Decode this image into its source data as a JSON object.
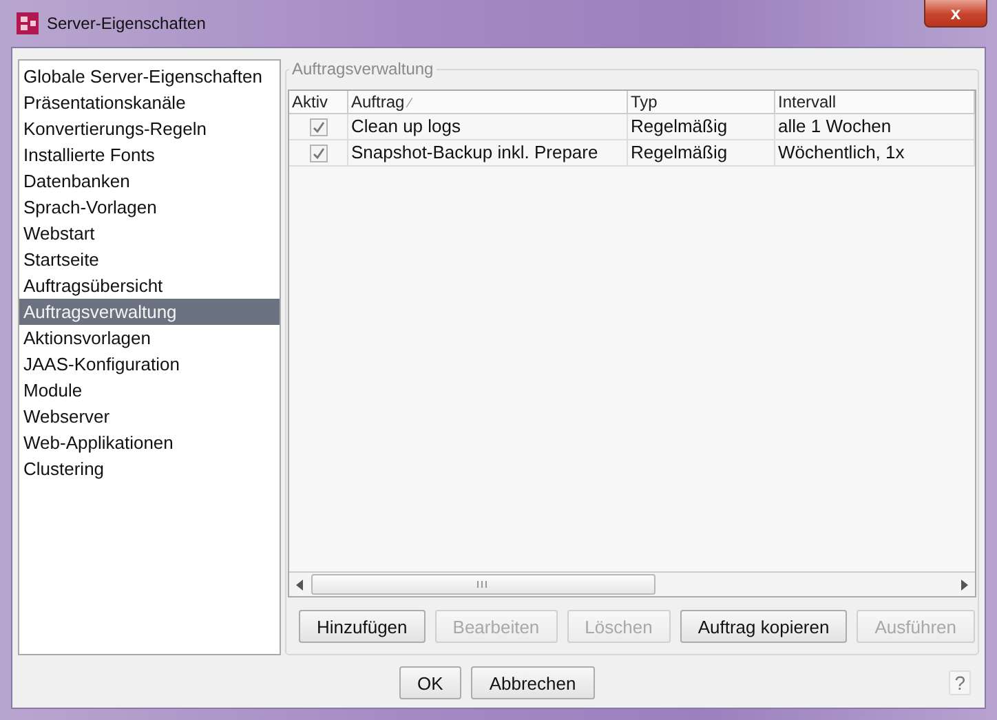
{
  "window": {
    "title": "Server-Eigenschaften",
    "close": "x"
  },
  "sidebar": {
    "items": [
      {
        "label": "Globale Server-Eigenschaften",
        "selected": false
      },
      {
        "label": "Präsentationskanäle",
        "selected": false
      },
      {
        "label": "Konvertierungs-Regeln",
        "selected": false
      },
      {
        "label": "Installierte Fonts",
        "selected": false
      },
      {
        "label": "Datenbanken",
        "selected": false
      },
      {
        "label": "Sprach-Vorlagen",
        "selected": false
      },
      {
        "label": "Webstart",
        "selected": false
      },
      {
        "label": "Startseite",
        "selected": false
      },
      {
        "label": "Auftragsübersicht",
        "selected": false
      },
      {
        "label": "Auftragsverwaltung",
        "selected": true
      },
      {
        "label": "Aktionsvorlagen",
        "selected": false
      },
      {
        "label": "JAAS-Konfiguration",
        "selected": false
      },
      {
        "label": "Module",
        "selected": false
      },
      {
        "label": "Webserver",
        "selected": false
      },
      {
        "label": "Web-Applikationen",
        "selected": false
      },
      {
        "label": "Clustering",
        "selected": false
      }
    ]
  },
  "panel": {
    "title": "Auftragsverwaltung",
    "table": {
      "check_column": "Aktiv",
      "columns": [
        "Auftrag",
        "Typ",
        "Intervall"
      ],
      "sort_indicator": "⁄",
      "rows": [
        {
          "checked": true,
          "cells": [
            "Clean up logs",
            "Regelmäßig",
            "alle 1 Wochen"
          ]
        },
        {
          "checked": true,
          "cells": [
            "Snapshot-Backup inkl. Prepare",
            "Regelmäßig",
            "Wöchentlich, 1x"
          ]
        }
      ]
    },
    "buttons": [
      {
        "label": "Hinzufügen",
        "disabled": false
      },
      {
        "label": "Bearbeiten",
        "disabled": true
      },
      {
        "label": "Löschen",
        "disabled": true
      },
      {
        "label": "Auftrag kopieren",
        "disabled": false
      },
      {
        "label": "Ausführen",
        "disabled": true
      }
    ]
  },
  "footer": {
    "buttons": [
      {
        "label": "OK",
        "disabled": false
      },
      {
        "label": "Abbrechen",
        "disabled": false
      }
    ],
    "help": "?"
  }
}
